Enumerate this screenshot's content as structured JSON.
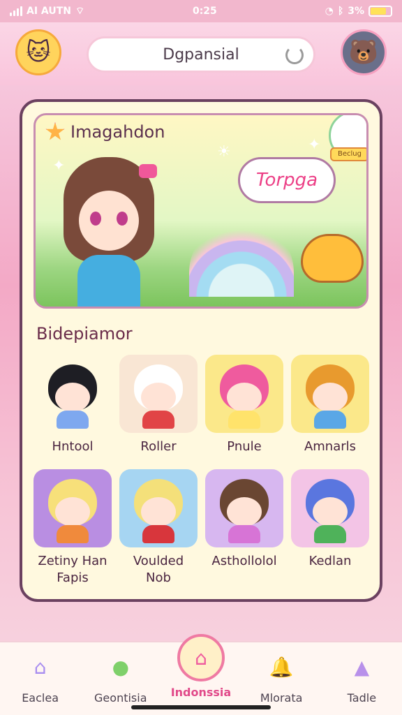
{
  "status_bar": {
    "carrier": "AI AUTN",
    "time": "0:25",
    "battery": "3%",
    "battery_fill": 0.8
  },
  "header": {
    "search_text": "Dgpansial",
    "left_avatar_icon": "cat-mascot-icon",
    "right_avatar_icon": "critter-mascot-icon"
  },
  "hero": {
    "title": "Imagahdon",
    "speech_bubble": "Torpga",
    "badge": "Beclug"
  },
  "section": {
    "title": "Bidepiamor"
  },
  "characters": [
    {
      "name": "Hntool",
      "bg": "#fff9df",
      "hair": "#1e1e24",
      "outfit": "#7ea8ef"
    },
    {
      "name": "Roller",
      "bg": "#f9e6d4",
      "hair": "#ffffff",
      "outfit": "#e14446"
    },
    {
      "name": "Pnule",
      "bg": "#fbe88a",
      "hair": "#ef5b9e",
      "outfit": "#ffe36b"
    },
    {
      "name": "Amnarls",
      "bg": "#fbe88a",
      "hair": "#e89a2e",
      "outfit": "#5aa7e6"
    },
    {
      "name": "Zetiny Han Fapis",
      "bg": "#b98ee2",
      "hair": "#f7e07a",
      "outfit": "#f08a3c"
    },
    {
      "name": "Voulded Nob",
      "bg": "#a6d5f2",
      "hair": "#f4e07a",
      "outfit": "#d8363c"
    },
    {
      "name": "Asthollolol",
      "bg": "#d7b7f0",
      "hair": "#6a4632",
      "outfit": "#d774d6"
    },
    {
      "name": "Kedlan",
      "bg": "#f3c4e6",
      "hair": "#5a76df",
      "outfit": "#4fb25a"
    }
  ],
  "nav": [
    {
      "label": "Eaclea",
      "icon": "house-icon",
      "color": "#a98ef0",
      "active": false
    },
    {
      "label": "Geontisia",
      "icon": "blob-icon",
      "color": "#7fd06a",
      "active": false
    },
    {
      "label": "Indonssia",
      "icon": "home-icon",
      "color": "#ef5b9e",
      "active": true
    },
    {
      "label": "Mlorata",
      "icon": "bell-icon",
      "color": "#ffb347",
      "active": false
    },
    {
      "label": "Tadle",
      "icon": "mountain-icon",
      "color": "#b890ea",
      "active": false
    }
  ]
}
